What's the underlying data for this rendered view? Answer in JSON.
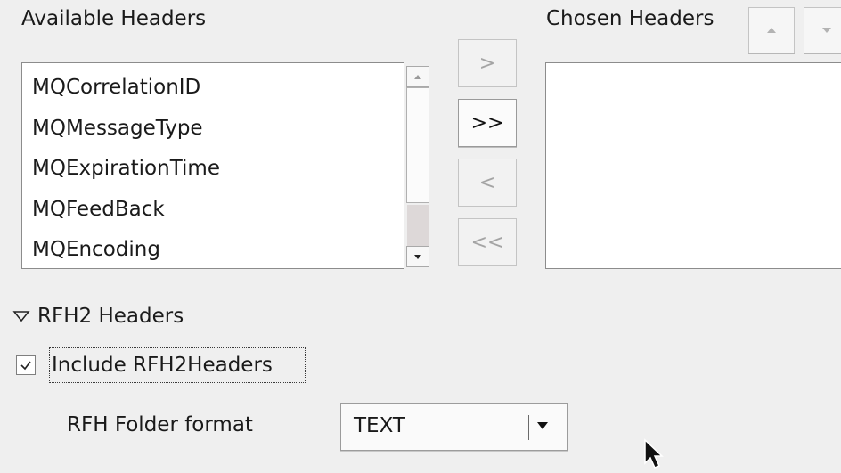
{
  "available": {
    "title": "Available Headers",
    "items": [
      "MQCorrelationID",
      "MQMessageType",
      "MQExpirationTime",
      "MQFeedBack",
      "MQEncoding"
    ],
    "scrollbar": {
      "up_icon": "scroll-up-arrow",
      "down_icon": "scroll-down-arrow"
    }
  },
  "transfer": {
    "add": ">",
    "add_all": ">>",
    "remove": "<",
    "remove_all": "<<"
  },
  "chosen": {
    "title": "Chosen Headers",
    "move_up_icon": "move-up-arrow",
    "move_down_icon": "move-down-arrow"
  },
  "rfh2": {
    "section_label": "RFH2 Headers",
    "expanded": true,
    "include_label": "Include RFH2Headers",
    "include_checked": true,
    "folder_format_label": "RFH Folder format",
    "folder_format_value": "TEXT"
  },
  "colors": {
    "background": "#efefef",
    "disabled_text": "#a4a4a4",
    "text": "#1a1a1a"
  }
}
